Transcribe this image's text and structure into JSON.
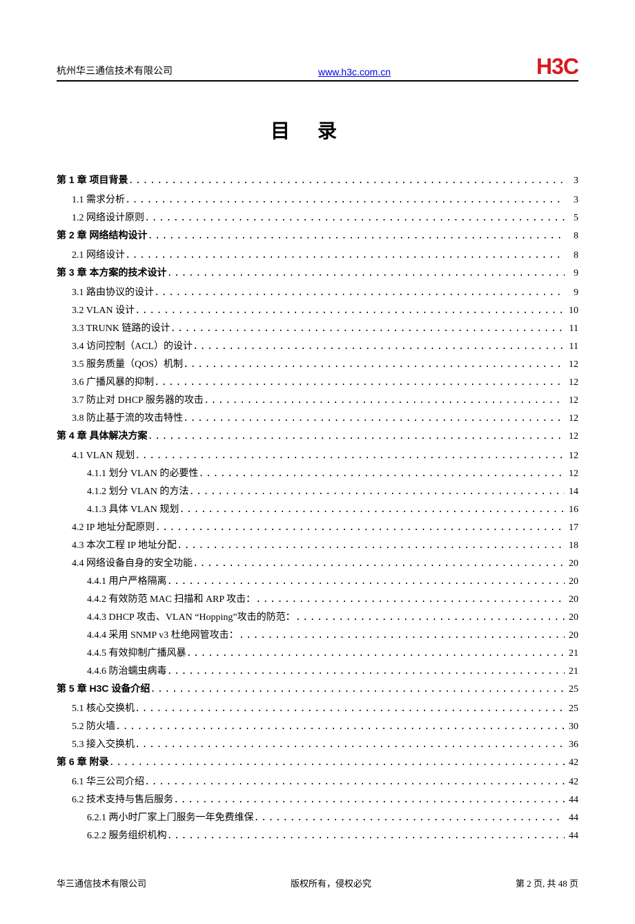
{
  "header": {
    "company": "杭州华三通信技术有限公司",
    "url": "www.h3c.com.cn",
    "logo": "H3C"
  },
  "title": "目录",
  "toc": [
    {
      "type": "ch",
      "label": "第 1 章 项目背景",
      "page": "3"
    },
    {
      "type": "lv1",
      "label": "1.1 需求分析",
      "page": "3"
    },
    {
      "type": "lv1",
      "label": "1.2 网络设计原则",
      "page": "5"
    },
    {
      "type": "ch",
      "label": "第 2 章 网络结构设计",
      "page": "8"
    },
    {
      "type": "lv1",
      "label": "2.1 网络设计",
      "page": "8"
    },
    {
      "type": "ch",
      "label": "第 3 章 本方案的技术设计",
      "page": "9"
    },
    {
      "type": "lv1",
      "label": "3.1 路由协议的设计",
      "page": "9"
    },
    {
      "type": "lv1",
      "label": "3.2 VLAN 设计",
      "page": "10"
    },
    {
      "type": "lv1",
      "label": "3.3 TRUNK 链路的设计",
      "page": "11"
    },
    {
      "type": "lv1",
      "label": "3.4 访问控制（ACL）的设计",
      "page": "11"
    },
    {
      "type": "lv1",
      "label": "3.5 服务质量（QOS）机制",
      "page": "12"
    },
    {
      "type": "lv1",
      "label": "3.6 广播风暴的抑制",
      "page": "12"
    },
    {
      "type": "lv1",
      "label": "3.7 防止对 DHCP 服务器的攻击",
      "page": "12"
    },
    {
      "type": "lv1",
      "label": "3.8 防止基于流的攻击特性",
      "page": "12"
    },
    {
      "type": "ch",
      "label": "第 4 章 具体解决方案",
      "page": "12"
    },
    {
      "type": "lv1",
      "label": "4.1 VLAN 规划",
      "page": "12"
    },
    {
      "type": "lv2",
      "label": "4.1.1 划分 VLAN 的必要性",
      "page": "12"
    },
    {
      "type": "lv2",
      "label": "4.1.2 划分 VLAN 的方法",
      "page": "14"
    },
    {
      "type": "lv2",
      "label": "4.1.3 具体 VLAN 规划",
      "page": "16"
    },
    {
      "type": "lv1",
      "label": "4.2 IP 地址分配原则",
      "page": "17"
    },
    {
      "type": "lv1",
      "label": "4.3 本次工程 IP 地址分配",
      "page": "18"
    },
    {
      "type": "lv1",
      "label": "4.4 网络设备自身的安全功能",
      "page": "20"
    },
    {
      "type": "lv2",
      "label": "4.4.1 用户严格隔离",
      "page": "20"
    },
    {
      "type": "lv2",
      "label": "4.4.2 有效防范 MAC 扫描和 ARP 攻击：",
      "page": "20"
    },
    {
      "type": "lv2",
      "label": "4.4.3 DHCP 攻击、VLAN “Hopping”攻击的防范：",
      "page": "20"
    },
    {
      "type": "lv2",
      "label": "4.4.4 采用 SNMP v3 杜绝网管攻击：",
      "page": "20"
    },
    {
      "type": "lv2",
      "label": "4.4.5 有效抑制广播风暴",
      "page": "21"
    },
    {
      "type": "lv2",
      "label": "4.4.6 防治蠕虫病毒",
      "page": "21"
    },
    {
      "type": "ch",
      "label": "第 5 章 H3C 设备介绍",
      "page": "25"
    },
    {
      "type": "lv1",
      "label": "5.1 核心交换机",
      "page": "25"
    },
    {
      "type": "lv1",
      "label": "5.2 防火墙",
      "page": "30"
    },
    {
      "type": "lv1",
      "label": "5.3 接入交换机",
      "page": "36"
    },
    {
      "type": "ch",
      "label": "第 6 章 附录",
      "page": "42"
    },
    {
      "type": "lv1",
      "label": "6.1 华三公司介绍",
      "page": "42"
    },
    {
      "type": "lv1",
      "label": "6.2 技术支持与售后服务",
      "page": "44"
    },
    {
      "type": "lv2",
      "label": "6.2.1 两小时厂家上门服务一年免费维保",
      "page": "44"
    },
    {
      "type": "lv2",
      "label": "6.2.2 服务组织机构",
      "page": "44"
    }
  ],
  "footer": {
    "left": "华三通信技术有限公司",
    "center": "版权所有，侵权必究",
    "right": "第 2 页, 共 48 页"
  }
}
